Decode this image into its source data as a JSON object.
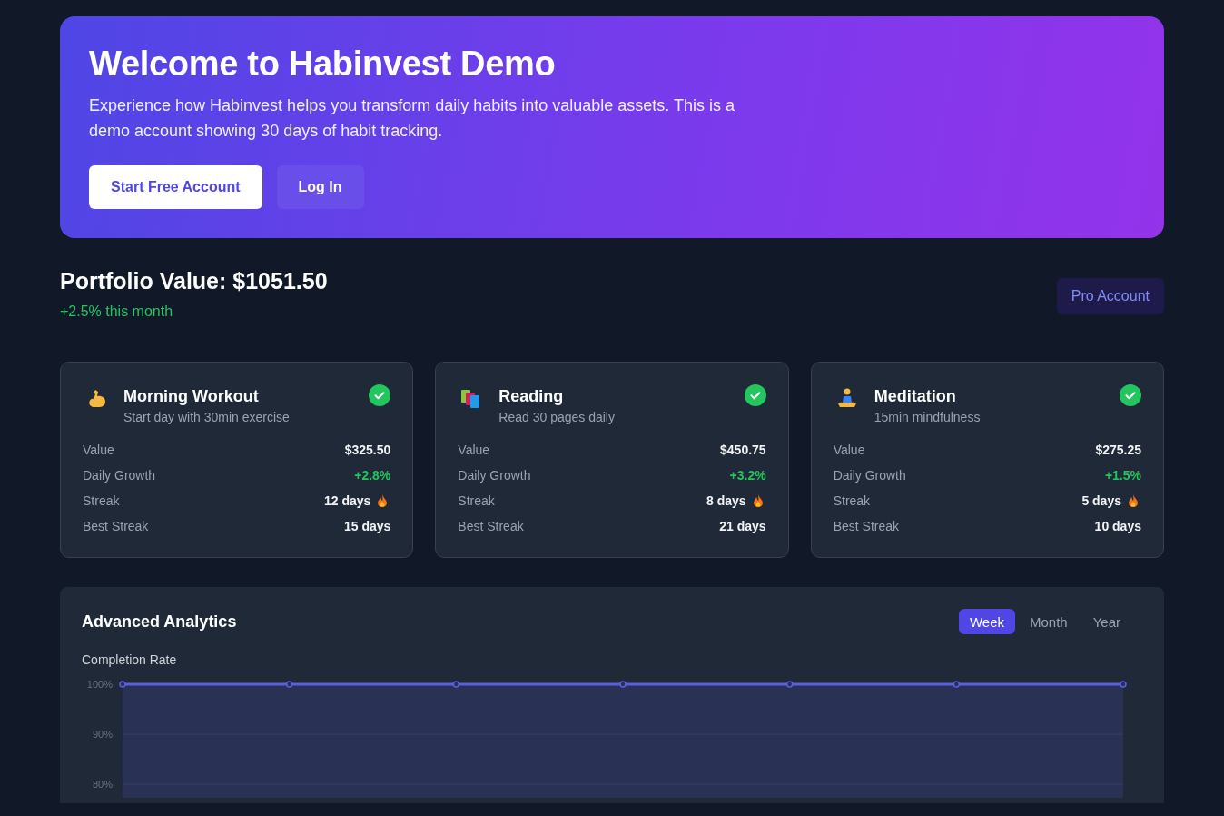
{
  "hero": {
    "title": "Welcome to Habinvest Demo",
    "text": "Experience how Habinvest helps you transform daily habits into valuable assets. This is a demo account showing 30 days of habit tracking.",
    "buttons": [
      {
        "label": "Start Free Account",
        "kind": "primary"
      },
      {
        "label": "Log In",
        "kind": "secondary"
      }
    ]
  },
  "portfolio": {
    "title": "Portfolio Value: $1051.50",
    "change": "+2.5% this month",
    "badge": "Pro Account"
  },
  "habits": [
    {
      "kind": "muscle",
      "name": "Morning Workout",
      "description": "Start day with 30min exercise",
      "done": true,
      "stats": [
        {
          "kind": "value",
          "label": "Value",
          "value": "$325.50"
        },
        {
          "kind": "growth",
          "label": "Daily Growth",
          "value": "+2.8%"
        },
        {
          "kind": "streak",
          "label": "Streak",
          "value": "12 days"
        },
        {
          "kind": "plain",
          "label": "Best Streak",
          "value": "15 days"
        }
      ]
    },
    {
      "kind": "books",
      "name": "Reading",
      "description": "Read 30 pages daily",
      "done": true,
      "stats": [
        {
          "kind": "value",
          "label": "Value",
          "value": "$450.75"
        },
        {
          "kind": "growth",
          "label": "Daily Growth",
          "value": "+3.2%"
        },
        {
          "kind": "streak",
          "label": "Streak",
          "value": "8 days"
        },
        {
          "kind": "plain",
          "label": "Best Streak",
          "value": "21 days"
        }
      ]
    },
    {
      "kind": "meditation",
      "name": "Meditation",
      "description": "15min mindfulness",
      "done": true,
      "stats": [
        {
          "kind": "value",
          "label": "Value",
          "value": "$275.25"
        },
        {
          "kind": "growth",
          "label": "Daily Growth",
          "value": "+1.5%"
        },
        {
          "kind": "streak",
          "label": "Streak",
          "value": "5 days"
        },
        {
          "kind": "plain",
          "label": "Best Streak",
          "value": "10 days"
        }
      ]
    }
  ],
  "analytics": {
    "title": "Advanced Analytics",
    "tabs": [
      {
        "label": "Week",
        "selected": true
      },
      {
        "label": "Month",
        "selected": false
      },
      {
        "label": "Year",
        "selected": false
      }
    ],
    "chart_label": "Completion Rate",
    "chart_data": {
      "type": "area",
      "ylim": [
        77.3,
        100
      ],
      "yticks": [
        {
          "value": 80,
          "label": "80%"
        },
        {
          "value": 90,
          "label": "90%"
        },
        {
          "value": 100,
          "label": "100%"
        }
      ],
      "series": [
        {
          "color": "#5b5fe0",
          "values": [
            100,
            100,
            100,
            100,
            100,
            100,
            100
          ]
        }
      ]
    }
  }
}
